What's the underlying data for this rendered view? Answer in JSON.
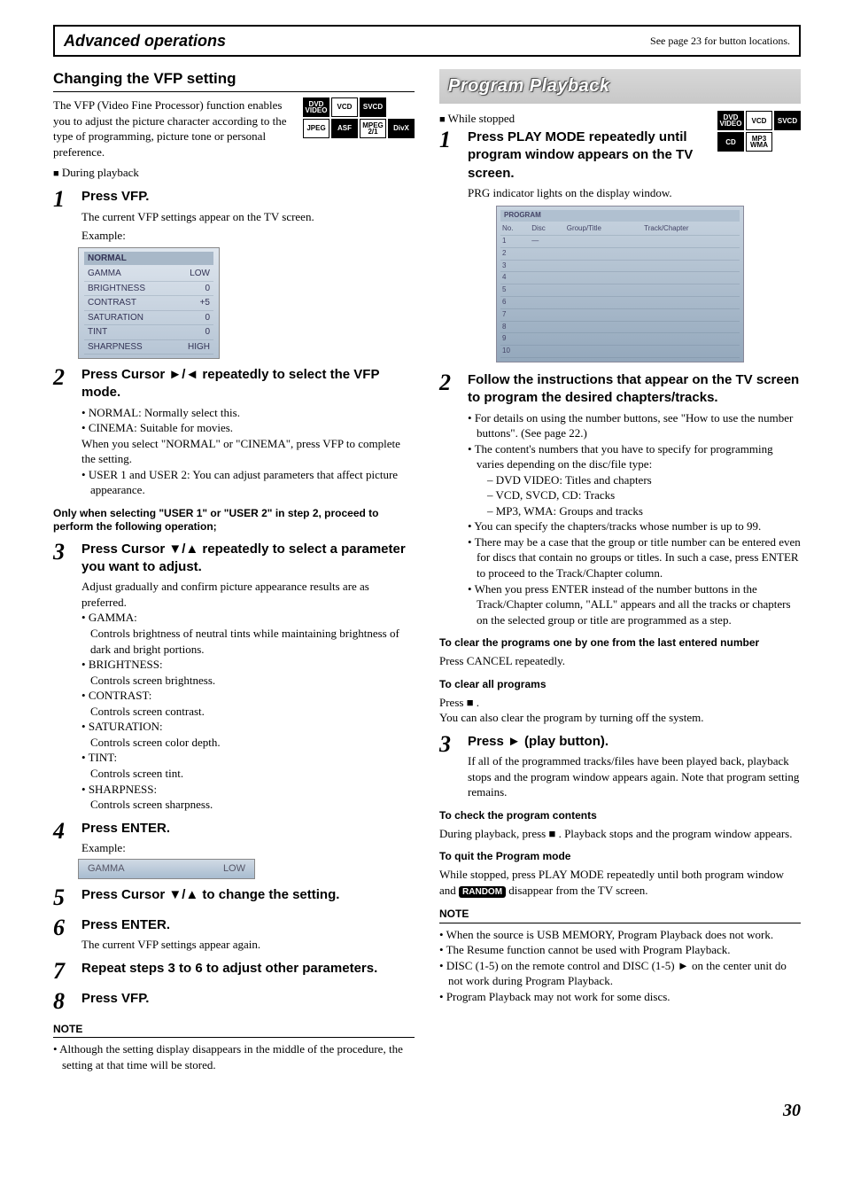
{
  "header": {
    "title": "Advanced operations",
    "note": "See page 23 for button locations."
  },
  "left": {
    "section_title": "Changing the VFP setting",
    "intro": "The VFP (Video Fine Processor) function enables you to adjust the picture character according to the type of programming, picture tone or personal preference.",
    "badges_r1": [
      "DVD\nVIDEO",
      "VCD",
      "SVCD"
    ],
    "badges_r2": [
      "JPEG",
      "ASF",
      "MPEG\n2/1",
      "DivX"
    ],
    "context": "During playback",
    "step1": {
      "head": "Press VFP.",
      "line1": "The current VFP settings appear on the TV screen.",
      "example_label": "Example:",
      "osd_title": "NORMAL",
      "osd_rows": [
        [
          "GAMMA",
          "LOW"
        ],
        [
          "BRIGHTNESS",
          "0"
        ],
        [
          "CONTRAST",
          "+5"
        ],
        [
          "SATURATION",
          "0"
        ],
        [
          "TINT",
          "0"
        ],
        [
          "SHARPNESS",
          "HIGH"
        ]
      ]
    },
    "step2": {
      "head": "Press Cursor ►/◄ repeatedly to select the VFP mode.",
      "b1": "NORMAL: Normally select this.",
      "b2": "CINEMA: Suitable for movies.",
      "line": "When you select \"NORMAL\" or \"CINEMA\", press VFP to complete the setting.",
      "b3": "USER 1 and USER 2: You can adjust parameters that affect picture appearance."
    },
    "mid_bold": "Only when selecting \"USER 1\" or \"USER 2\" in step 2, proceed to perform the following operation;",
    "step3": {
      "head": "Press Cursor ▼/▲ repeatedly to select a parameter you want to adjust.",
      "intro": "Adjust gradually and confirm picture appearance results are as preferred.",
      "items": [
        {
          "k": "GAMMA:",
          "v": "Controls brightness of neutral tints while maintaining brightness of dark and bright portions."
        },
        {
          "k": "BRIGHTNESS:",
          "v": "Controls screen brightness."
        },
        {
          "k": "CONTRAST:",
          "v": "Controls screen contrast."
        },
        {
          "k": "SATURATION:",
          "v": "Controls screen color depth."
        },
        {
          "k": "TINT:",
          "v": "Controls screen tint."
        },
        {
          "k": "SHARPNESS:",
          "v": "Controls screen sharpness."
        }
      ]
    },
    "step4": {
      "head": "Press ENTER.",
      "example_label": "Example:",
      "bar_l": "GAMMA",
      "bar_r": "LOW"
    },
    "step5": {
      "head": "Press Cursor ▼/▲ to change the setting."
    },
    "step6": {
      "head": "Press ENTER.",
      "line": "The current VFP settings appear again."
    },
    "step7": {
      "head": "Repeat steps 3 to 6 to adjust other parameters."
    },
    "step8": {
      "head": "Press VFP."
    },
    "note_head": "NOTE",
    "note_item": "Although the setting display disappears in the middle of the procedure, the setting at that time will be stored."
  },
  "right": {
    "banner": "Program Playback",
    "context": "While stopped",
    "badges_r1": [
      "DVD\nVIDEO",
      "VCD",
      "SVCD"
    ],
    "badges_r2": [
      "CD",
      "MP3\nWMA"
    ],
    "step1": {
      "head": "Press PLAY MODE repeatedly until program window appears on the TV screen.",
      "line": "PRG indicator lights on the display window.",
      "prog_head": "PROGRAM",
      "cols": [
        "No.",
        "Disc",
        "Group/Title",
        "Track/Chapter"
      ],
      "nums": [
        "1",
        "2",
        "3",
        "4",
        "5",
        "6",
        "7",
        "8",
        "9",
        "10"
      ]
    },
    "step2": {
      "head": "Follow the instructions that appear on the TV screen to program the desired chapters/tracks.",
      "b1": "For details on using the number buttons, see \"How to use the number buttons\". (See page 22.)",
      "b2": "The content's numbers that you have to specify for programming varies depending on the disc/file type:",
      "d1": "DVD VIDEO: Titles and chapters",
      "d2": "VCD, SVCD, CD: Tracks",
      "d3": "MP3, WMA: Groups and tracks",
      "b3": "You can specify the chapters/tracks whose number is up to 99.",
      "b4": "There may be a case that the group or title number can be entered even for discs that contain no groups or titles. In such a case, press ENTER to proceed to the Track/Chapter column.",
      "b5": "When you press ENTER instead of the number buttons in the Track/Chapter column, \"ALL\" appears and all the tracks or chapters on the selected group or title are programmed as a step."
    },
    "sub1_h": "To clear the programs one by one from the last entered number",
    "sub1_t": "Press CANCEL repeatedly.",
    "sub2_h": "To clear all programs",
    "sub2_t1": "Press ■ .",
    "sub2_t2": "You can also clear the program by turning off the system.",
    "step3": {
      "head": "Press ► (play button).",
      "line": "If all of the programmed tracks/files have been played back, playback stops and the program window appears again. Note that program setting remains."
    },
    "sub3_h": "To check the program contents",
    "sub3_t": "During playback, press ■ . Playback stops and the program window appears.",
    "sub4_h": "To quit the Program mode",
    "sub4_t1": "While stopped, press PLAY MODE repeatedly until both program window and ",
    "sub4_chip": "RANDOM",
    "sub4_t2": " disappear from the TV screen.",
    "note_head": "NOTE",
    "notes": [
      "When the source is USB MEMORY, Program Playback does not work.",
      "The Resume function cannot be used with Program Playback.",
      "DISC (1-5) on the remote control and DISC (1-5) ► on the center unit do not work during Program Playback.",
      "Program Playback may not work for some discs."
    ]
  },
  "page_num": "30"
}
